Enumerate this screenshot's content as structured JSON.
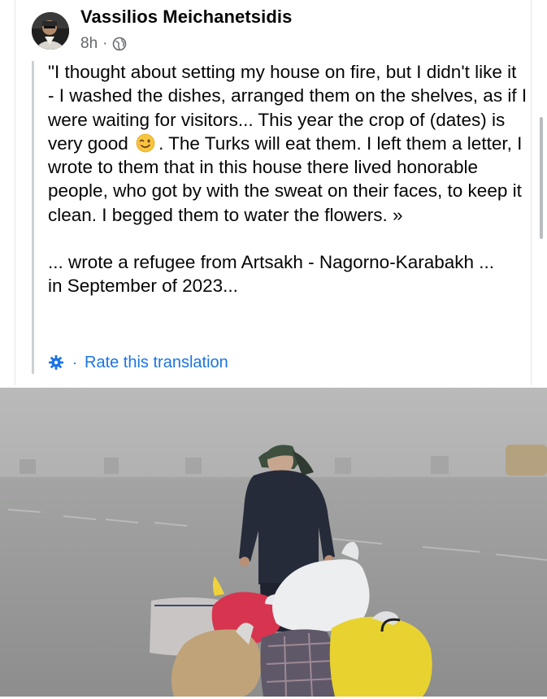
{
  "post": {
    "author": "Vassilios Meichanetsidis",
    "time": "8h",
    "separator": "·",
    "audience_icon": "globe-icon",
    "avatar_icon": "profile-photo",
    "body": {
      "para1_before_emoji": "\"I thought about setting my house on fire, but I didn't like it - I washed the dishes, arranged them on the shelves, as if I were waiting for visitors... This year the crop of (dates) is very good",
      "emoji": "winking-face-emoji",
      "para1_after_emoji": ". The Turks will eat them. I left them a letter, I wrote to them that in this house there lived honorable people, who got by with the sweat on their faces, to keep it clean. I begged them to water the flowers. »",
      "para2_line1": "... wrote a refugee from Artsakh - Nagorno-Karabakh ...",
      "para2_line2": "in September of 2023..."
    },
    "translation": {
      "icon": "gear-icon",
      "separator": "·",
      "rate_label": "Rate this translation"
    },
    "photo": {
      "subject": "photo-refugee-woman-with-bags"
    }
  },
  "colors": {
    "text": "#050505",
    "meta": "#65676b",
    "link": "#1b74e4",
    "quote_bar": "#ced0d4"
  }
}
